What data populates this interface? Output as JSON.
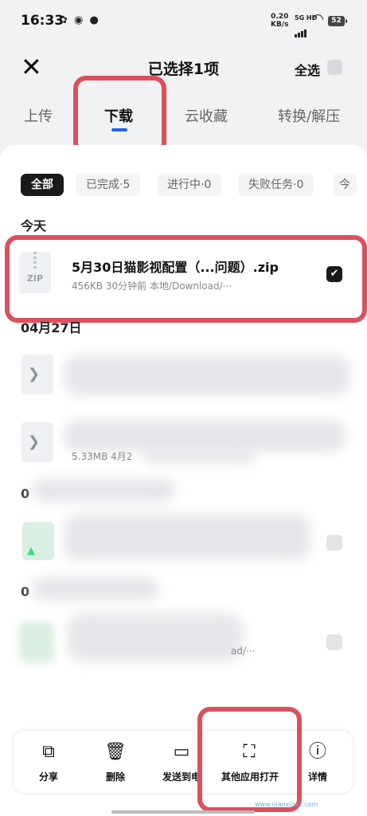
{
  "status": {
    "time": "16:33",
    "net_rate": "0.20",
    "net_unit": "KB/s",
    "signal": "5G HD",
    "battery": "52"
  },
  "header": {
    "title": "已选择1项",
    "select_all": "全选"
  },
  "tabs": [
    {
      "label": "上传"
    },
    {
      "label": "下载"
    },
    {
      "label": "云收藏"
    },
    {
      "label": "转换/解压"
    }
  ],
  "filters": [
    {
      "label": "全部"
    },
    {
      "label": "已完成·5"
    },
    {
      "label": "进行中·0"
    },
    {
      "label": "失败任务·0"
    },
    {
      "label": "今"
    }
  ],
  "groups": {
    "today": "今天",
    "apr27": "04月27日",
    "g3": "0",
    "g4": "0"
  },
  "file": {
    "icon_label": "ZIP",
    "name": "5月30日猫影视配置（...问题）.zip",
    "meta": "456KB  30分钟前   本地/Download/···"
  },
  "blurred": {
    "row2_meta": "5.33MB  4月2",
    "row4_meta": "ad/···"
  },
  "actions": [
    {
      "label": "分享",
      "icon": "share-icon"
    },
    {
      "label": "删除",
      "icon": "trash-icon"
    },
    {
      "label": "发送到电",
      "icon": "send-to-pc-icon"
    },
    {
      "label": "其他应用打开",
      "icon": "open-with-icon"
    },
    {
      "label": "详情",
      "icon": "info-icon"
    }
  ],
  "watermark": "www.nianxinxz.com",
  "colors": {
    "accent": "#1d63ed",
    "highlight": "#dc505e"
  }
}
